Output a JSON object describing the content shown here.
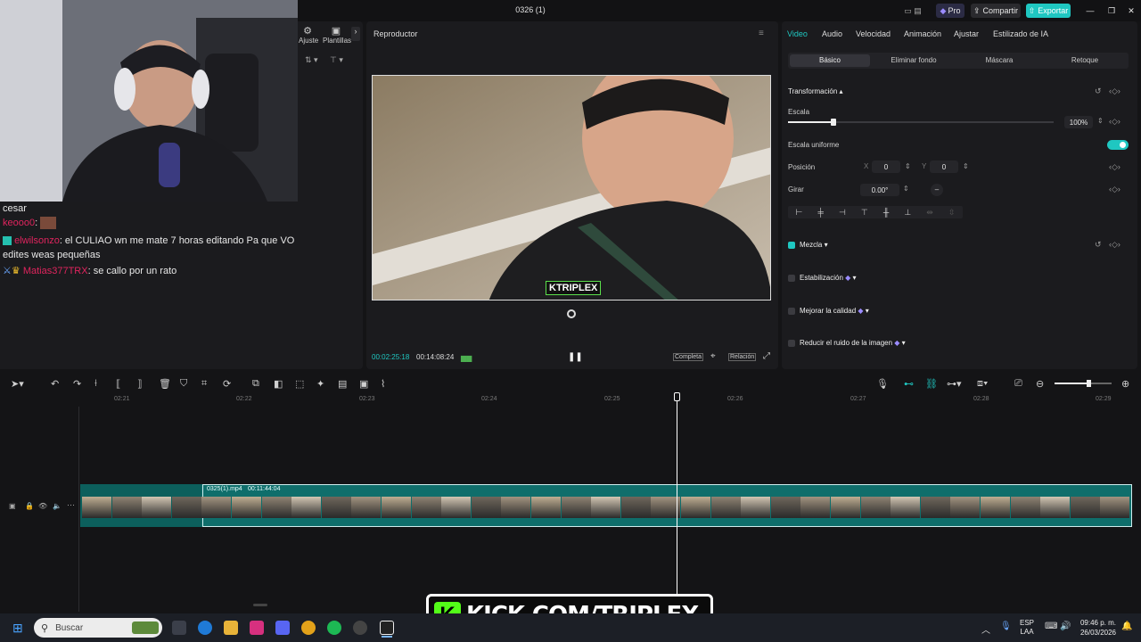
{
  "window": {
    "title": "0326 (1)",
    "pro_label": "Pro",
    "share_label": "Compartir",
    "export_label": "Exportar"
  },
  "left_panel": {
    "tabs": [
      "Ajuste",
      "Plantillas"
    ]
  },
  "chat": {
    "lines": [
      {
        "user": "",
        "text": "cesar"
      },
      {
        "user": "keooo0",
        "text": ":"
      },
      {
        "user": "elwilsonzo",
        "text": ": el CULIAO wn me mate 7 horas editando Pa que VO"
      },
      {
        "user": "",
        "text": "edites weas pequeñas"
      },
      {
        "user": "Matias377TRX",
        "text": ": se callo por un rato"
      }
    ],
    "user_color": "#e0245e"
  },
  "player": {
    "title": "Reproductor",
    "current_time": "00:02:25:18",
    "total_time": "00:14:08:24",
    "full_label": "Completa",
    "ratio_label": "Relación",
    "watermark": "KTRIPLEX"
  },
  "props": {
    "tabs": [
      "Video",
      "Audio",
      "Velocidad",
      "Animación",
      "Ajustar",
      "Estilizado de IA"
    ],
    "subtabs": [
      "Básico",
      "Eliminar fondo",
      "Máscara",
      "Retoque"
    ],
    "section_transform": "Transformación",
    "scale_label": "Escala",
    "scale_value": "100%",
    "scale_fraction": 0.17,
    "uniform_label": "Escala uniforme",
    "position_label": "Posición",
    "pos_x_label": "X",
    "pos_x": "0",
    "pos_y_label": "Y",
    "pos_y": "0",
    "rotate_label": "Girar",
    "rotate_value": "0.00°",
    "blend_label": "Mezcla",
    "stabilize_label": "Estabilización",
    "quality_label": "Mejorar la calidad",
    "noise_label": "Reducir el ruido de la imagen",
    "accent": "#1fc7c1"
  },
  "timeline": {
    "ruler": [
      "02:21",
      "02:22",
      "02:23",
      "02:24",
      "02:25",
      "02:26",
      "02:27",
      "02:28",
      "02:29"
    ],
    "clip_name": "0325(1).mp4",
    "clip_duration": "00:11:44:04"
  },
  "overlay": {
    "brand": "KICK.COM/TRIPLEX"
  },
  "taskbar": {
    "search_placeholder": "Buscar",
    "lang_top": "ESP",
    "lang_bottom": "LAA",
    "time": "09:46 p. m.",
    "date": "26/03/2026"
  }
}
